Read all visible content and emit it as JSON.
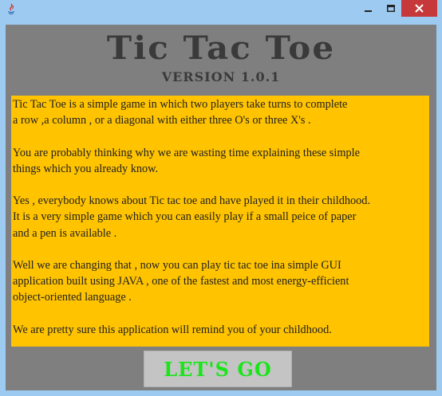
{
  "window": {
    "icon": "java-app-icon",
    "controls": [
      "minimize-icon",
      "maximize-icon",
      "close-icon"
    ],
    "close_color": "#c7383a"
  },
  "header": {
    "title": "Tic Tac Toe",
    "version": "VERSION 1.0.1"
  },
  "description": {
    "background": "#ffc300",
    "paragraphs": [
      "Tic Tac Toe is a simple game in which two players take turns to complete\na row ,a column , or a diagonal with either three O's or three X's .",
      "You are probably thinking why we are wasting time explaining these simple\nthings which you already know.",
      "Yes , everybody knows about Tic tac toe and have played it in their childhood.\nIt is a very simple game which you can easily play if a small peice of paper\nand a pen is available .",
      "Well we are changing that , now you can play tic tac toe ina simple GUI\napplication built using JAVA , one of the fastest and most energy-efficient\nobject-oriented language .",
      "We are pretty sure this application will remind you of your childhood."
    ]
  },
  "action": {
    "label": "LET'S GO",
    "text_color": "#1ae51a"
  }
}
